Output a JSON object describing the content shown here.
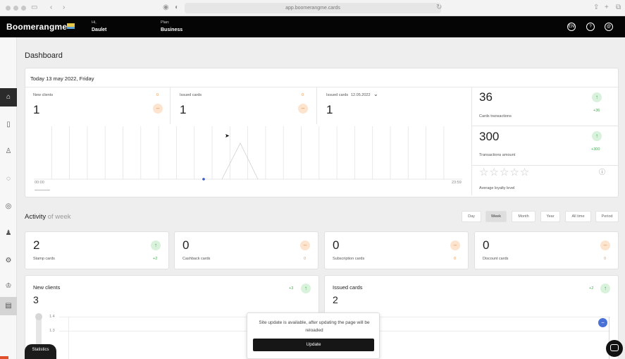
{
  "browser": {
    "url": "app.boomerangme.cards"
  },
  "header": {
    "logo": "Boomerangme",
    "greeting_label": "Hi,",
    "user_name": "Daulet",
    "plan_label": "Plan:",
    "plan_name": "Business",
    "lang": "EN",
    "help_icon": "?",
    "profile_icon": "@"
  },
  "sidebar": {
    "items": [
      "home-icon",
      "cards-icon",
      "users-icon",
      "chat-icon",
      "location-icon",
      "team-icon",
      "settings-icon",
      "crown-icon",
      "store-icon"
    ]
  },
  "page": {
    "title": "Dashboard"
  },
  "today": {
    "heading": "Today 13 may 2022, Friday",
    "metrics": [
      {
        "label": "New clients",
        "value": "1",
        "delta": "0"
      },
      {
        "label": "Issued cards",
        "value": "1",
        "delta": "0"
      },
      {
        "label": "Issued cards",
        "date": "12.05.2022",
        "value": "1"
      }
    ],
    "axis_start": "00:00",
    "axis_end": "23:59",
    "side": [
      {
        "value": "36",
        "label": "Cards transactions",
        "delta": "+36"
      },
      {
        "value": "300",
        "label": "Transactions amount",
        "delta": "+300"
      },
      {
        "label": "Average loyalty level",
        "stars": 0,
        "max_stars": 5
      }
    ]
  },
  "activity": {
    "title": "Activity",
    "title_suffix": "of week",
    "periods": [
      "Day",
      "Week",
      "Month",
      "Year",
      "All time",
      "Period"
    ],
    "active_period": "Week",
    "cards": [
      {
        "value": "2",
        "label": "Stamp cards",
        "delta": "+2",
        "trend": "up"
      },
      {
        "value": "0",
        "label": "Cashback cards",
        "delta": "0",
        "trend": "flat"
      },
      {
        "value": "0",
        "label": "Subscription cards",
        "delta": "0",
        "trend": "flat"
      },
      {
        "value": "0",
        "label": "Discount cards",
        "delta": "0",
        "trend": "flat"
      }
    ],
    "new_clients": {
      "title": "New clients",
      "value": "3",
      "delta": "+3",
      "y_ticks": [
        "1.4",
        "1.3"
      ]
    },
    "issued_cards": {
      "title": "Issued cards",
      "value": "2",
      "delta": "+2"
    }
  },
  "statistics_tab": "Statistics",
  "update_notice": {
    "text": "Site update is available, after updating the page will be reloaded",
    "button": "Update"
  }
}
